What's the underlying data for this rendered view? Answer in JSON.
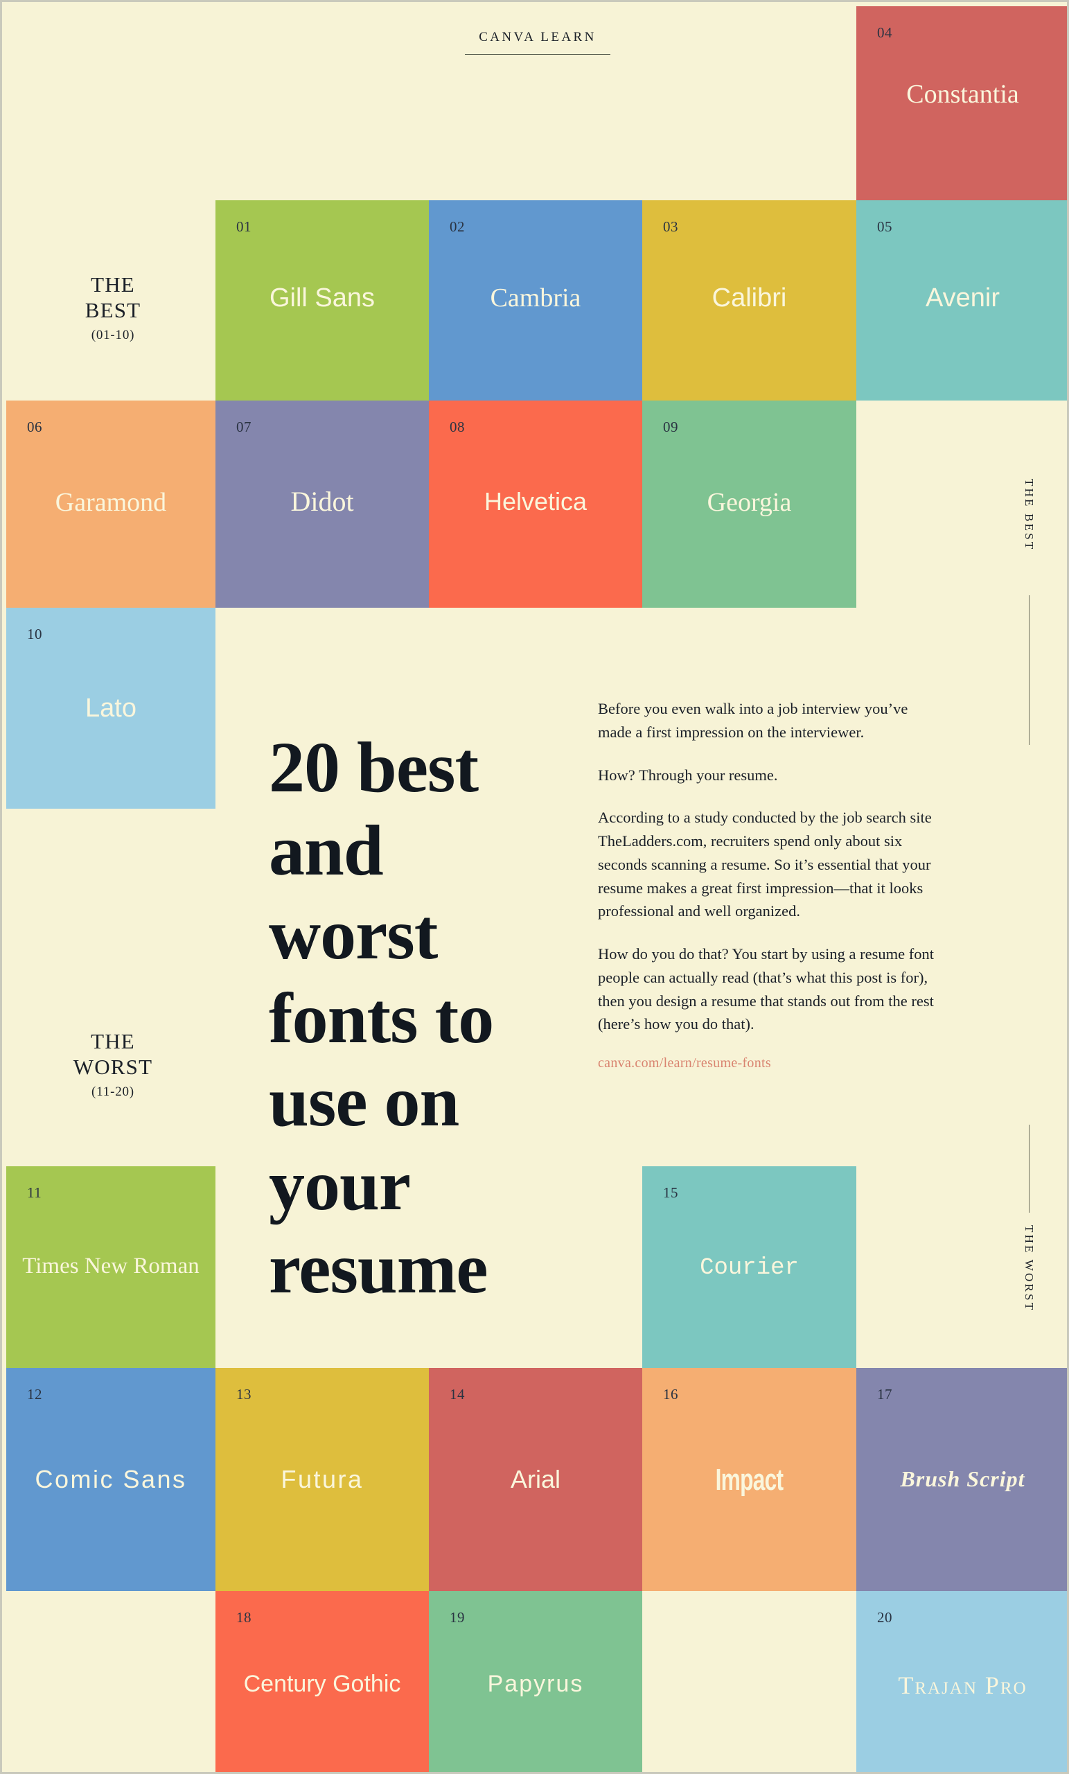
{
  "brand": {
    "label": "CANVA LEARN"
  },
  "sections": {
    "best": {
      "line1": "THE",
      "line2": "BEST",
      "range": "(01-10)",
      "vertical": "THE BEST"
    },
    "worst": {
      "line1": "THE",
      "line2": "WORST",
      "range": "(11-20)",
      "vertical": "THE WORST"
    }
  },
  "headline": "20 best and worst fonts to use on your resume",
  "body": {
    "p1": "Before you even walk into a job interview you’ve made a first impression on the interviewer.",
    "p2": "How? Through your resume.",
    "p3": "According to a study conducted by the job search site TheLadders.com, recruiters spend only about six seconds scanning a resume. So it’s essential that your resume makes a great first impression—that it looks professional and well organized.",
    "p4": "How do you do that? You start by using a resume font people can actually read (that’s what this post is for), then you design a resume that stands out from the rest (here’s how you do that).",
    "url": "canva.com/learn/resume-fonts"
  },
  "colors": {
    "background": "#F7F3D6",
    "text_cream": "#FAF6DC",
    "ink": "#1b2028",
    "link": "#D98470",
    "green": "#A5C751",
    "blue": "#6198CF",
    "yellow": "#DEBE3D",
    "red": "#D0645F",
    "teal": "#7CC7C0",
    "orange": "#F5AE72",
    "purple": "#8486AD",
    "coral": "#FB6A4D",
    "seagreen": "#7FC392",
    "skyblue": "#9BCEE3"
  },
  "fonts": [
    {
      "num": "01",
      "name": "Gill Sans",
      "bg": "#A5C751",
      "size": 38
    },
    {
      "num": "02",
      "name": "Cambria",
      "bg": "#6198CF",
      "size": 38
    },
    {
      "num": "03",
      "name": "Calibri",
      "bg": "#DEBE3D",
      "size": 38
    },
    {
      "num": "04",
      "name": "Constantia",
      "bg": "#D0645F",
      "size": 38
    },
    {
      "num": "05",
      "name": "Avenir",
      "bg": "#7CC7C0",
      "size": 38
    },
    {
      "num": "06",
      "name": "Garamond",
      "bg": "#F5AE72",
      "size": 38
    },
    {
      "num": "07",
      "name": "Didot",
      "bg": "#8486AD",
      "size": 38
    },
    {
      "num": "08",
      "name": "Helvetica",
      "bg": "#FB6A4D",
      "size": 36
    },
    {
      "num": "09",
      "name": "Georgia",
      "bg": "#7FC392",
      "size": 38
    },
    {
      "num": "10",
      "name": "Lato",
      "bg": "#9BCEE3",
      "size": 38
    },
    {
      "num": "11",
      "name": "Times New Roman",
      "bg": "#A5C751",
      "size": 33
    },
    {
      "num": "12",
      "name": "Comic Sans",
      "bg": "#6198CF",
      "size": 36
    },
    {
      "num": "13",
      "name": "Futura",
      "bg": "#DEBE3D",
      "size": 36
    },
    {
      "num": "14",
      "name": "Arial",
      "bg": "#D0645F",
      "size": 36
    },
    {
      "num": "15",
      "name": "Courier",
      "bg": "#7CC7C0",
      "size": 34
    },
    {
      "num": "16",
      "name": "Impact",
      "bg": "#F5AE72",
      "size": 40
    },
    {
      "num": "17",
      "name": "Brush Script",
      "bg": "#8486AD",
      "size": 32
    },
    {
      "num": "18",
      "name": "Century Gothic",
      "bg": "#FB6A4D",
      "size": 34
    },
    {
      "num": "19",
      "name": "Papyrus",
      "bg": "#7FC392",
      "size": 34
    },
    {
      "num": "20",
      "name": "Trajan Pro",
      "bg": "#9BCEE3",
      "size": 34
    }
  ]
}
